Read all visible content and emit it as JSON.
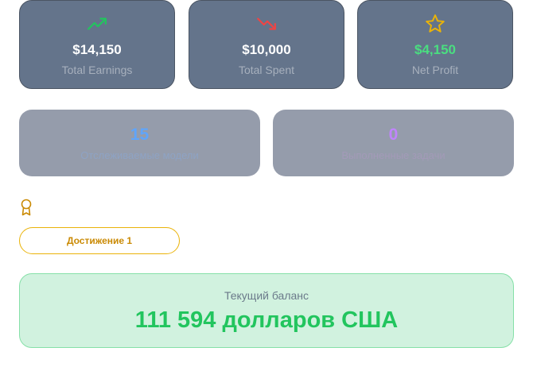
{
  "stats": [
    {
      "icon": "trending-up-icon",
      "value": "$14,150",
      "label": "Total Earnings",
      "accent": "#22c55e"
    },
    {
      "icon": "trending-down-icon",
      "value": "$10,000",
      "label": "Total Spent",
      "accent": "#ef4444"
    },
    {
      "icon": "star-icon",
      "value": "$4,150",
      "label": "Net Profit",
      "accent": "#eab308"
    }
  ],
  "secondary": [
    {
      "value": "15",
      "label": "Отслеживаемые модели",
      "color": "#60a5fa"
    },
    {
      "value": "0",
      "label": "Выполненные задачи",
      "color": "#c084fc"
    }
  ],
  "achievements": {
    "icon": "award-icon",
    "button_label": "Достижение 1"
  },
  "balance": {
    "label": "Текущий баланс",
    "value": "111 594 долларов США",
    "color": "#22c55e"
  }
}
